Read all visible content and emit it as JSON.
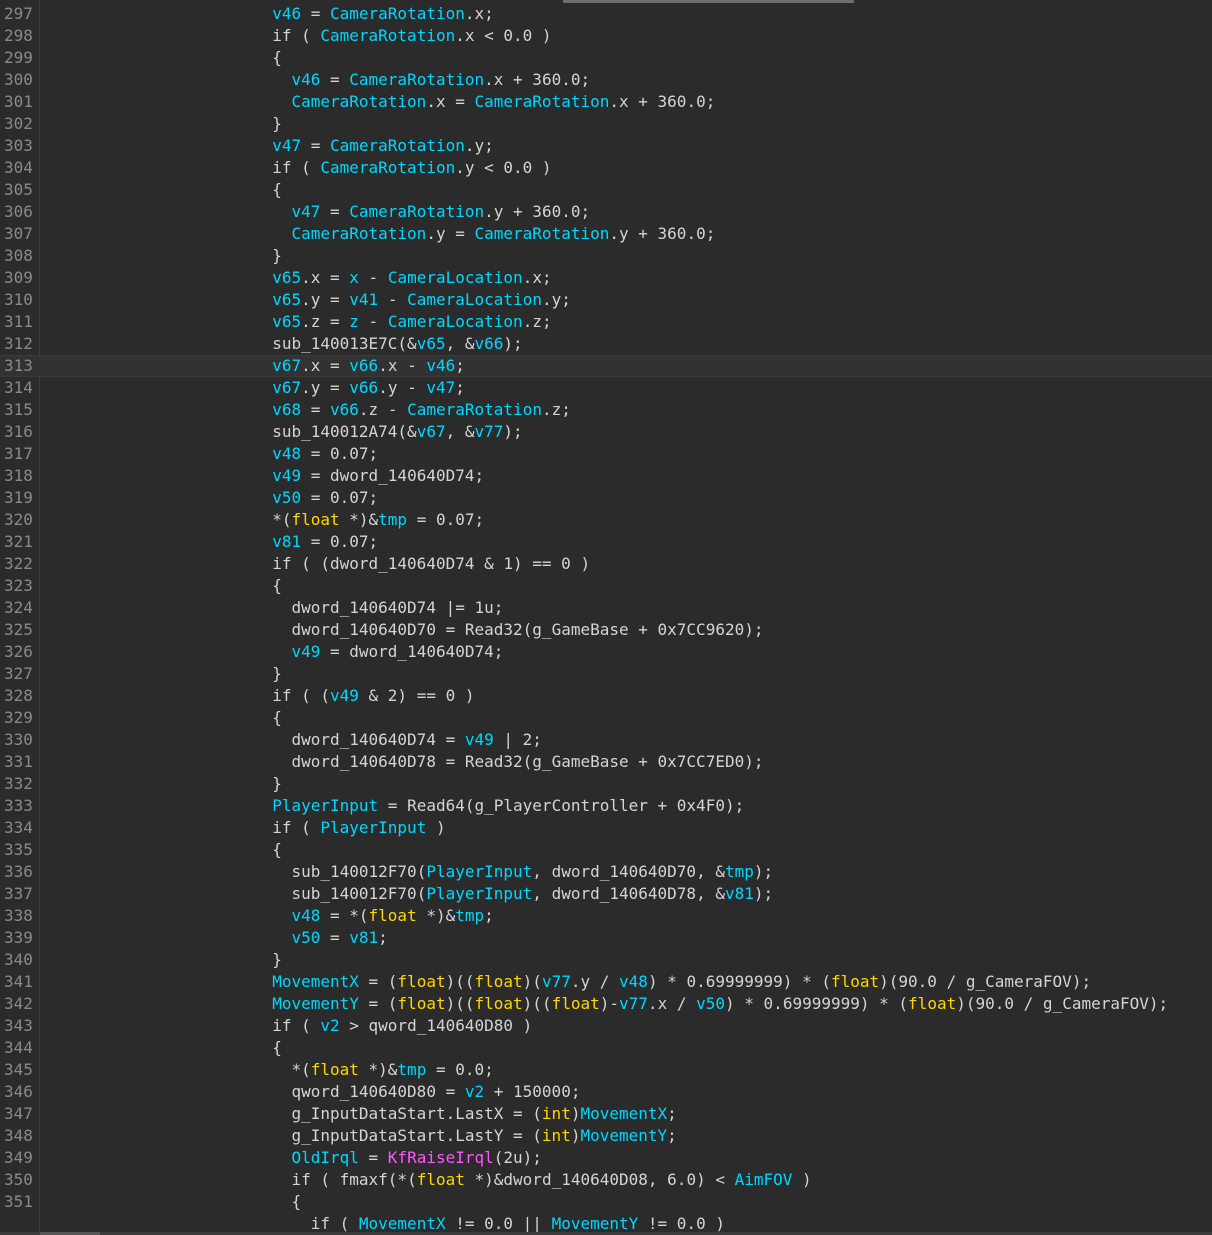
{
  "lines": [
    {
      "n": "297",
      "t": "                        v46 = CameraRotation.x;"
    },
    {
      "n": "298",
      "t": "                        if ( CameraRotation.x < 0.0 )"
    },
    {
      "n": "299",
      "t": "                        {"
    },
    {
      "n": "300",
      "t": "                          v46 = CameraRotation.x + 360.0;"
    },
    {
      "n": "301",
      "t": "                          CameraRotation.x = CameraRotation.x + 360.0;"
    },
    {
      "n": "302",
      "t": "                        }"
    },
    {
      "n": "303",
      "t": "                        v47 = CameraRotation.y;"
    },
    {
      "n": "304",
      "t": "                        if ( CameraRotation.y < 0.0 )"
    },
    {
      "n": "305",
      "t": "                        {"
    },
    {
      "n": "306",
      "t": "                          v47 = CameraRotation.y + 360.0;"
    },
    {
      "n": "307",
      "t": "                          CameraRotation.y = CameraRotation.y + 360.0;"
    },
    {
      "n": "308",
      "t": "                        }"
    },
    {
      "n": "309",
      "t": "                        v65.x = x - CameraLocation.x;"
    },
    {
      "n": "310",
      "t": "                        v65.y = v41 - CameraLocation.y;"
    },
    {
      "n": "311",
      "t": "                        v65.z = z - CameraLocation.z;"
    },
    {
      "n": "312",
      "t": "                        sub_140013E7C(&v65, &v66);"
    },
    {
      "n": "313",
      "t": "                        v67.x = v66.x - v46;"
    },
    {
      "n": "314",
      "t": "                        v67.y = v66.y - v47;"
    },
    {
      "n": "315",
      "t": "                        v68 = v66.z - CameraRotation.z;"
    },
    {
      "n": "316",
      "t": "                        sub_140012A74(&v67, &v77);"
    },
    {
      "n": "317",
      "t": "                        v48 = 0.07;"
    },
    {
      "n": "318",
      "t": "                        v49 = dword_140640D74;"
    },
    {
      "n": "319",
      "t": "                        v50 = 0.07;"
    },
    {
      "n": "320",
      "t": "                        *(float *)&tmp = 0.07;"
    },
    {
      "n": "321",
      "t": "                        v81 = 0.07;"
    },
    {
      "n": "322",
      "t": "                        if ( (dword_140640D74 & 1) == 0 )"
    },
    {
      "n": "323",
      "t": "                        {"
    },
    {
      "n": "324",
      "t": "                          dword_140640D74 |= 1u;"
    },
    {
      "n": "325",
      "t": "                          dword_140640D70 = Read32(g_GameBase + 0x7CC9620);"
    },
    {
      "n": "326",
      "t": "                          v49 = dword_140640D74;"
    },
    {
      "n": "327",
      "t": "                        }"
    },
    {
      "n": "328",
      "t": "                        if ( (v49 & 2) == 0 )"
    },
    {
      "n": "329",
      "t": "                        {"
    },
    {
      "n": "330",
      "t": "                          dword_140640D74 = v49 | 2;"
    },
    {
      "n": "331",
      "t": "                          dword_140640D78 = Read32(g_GameBase + 0x7CC7ED0);"
    },
    {
      "n": "332",
      "t": "                        }"
    },
    {
      "n": "333",
      "t": "                        PlayerInput = Read64(g_PlayerController + 0x4F0);"
    },
    {
      "n": "334",
      "t": "                        if ( PlayerInput )"
    },
    {
      "n": "335",
      "t": "                        {"
    },
    {
      "n": "336",
      "t": "                          sub_140012F70(PlayerInput, dword_140640D70, &tmp);"
    },
    {
      "n": "337",
      "t": "                          sub_140012F70(PlayerInput, dword_140640D78, &v81);"
    },
    {
      "n": "338",
      "t": "                          v48 = *(float *)&tmp;"
    },
    {
      "n": "339",
      "t": "                          v50 = v81;"
    },
    {
      "n": "340",
      "t": "                        }"
    },
    {
      "n": "341",
      "t": "                        MovementX = (float)((float)(v77.y / v48) * 0.69999999) * (float)(90.0 / g_CameraFOV);"
    },
    {
      "n": "342",
      "t": "                        MovementY = (float)((float)((float)-v77.x / v50) * 0.69999999) * (float)(90.0 / g_CameraFOV);"
    },
    {
      "n": "343",
      "t": "                        if ( v2 > qword_140640D80 )"
    },
    {
      "n": "344",
      "t": "                        {"
    },
    {
      "n": "345",
      "t": "                          *(float *)&tmp = 0.0;"
    },
    {
      "n": "346",
      "t": "                          qword_140640D80 = v2 + 150000;"
    },
    {
      "n": "347",
      "t": "                          g_InputDataStart.LastX = (int)MovementX;"
    },
    {
      "n": "348",
      "t": "                          g_InputDataStart.LastY = (int)MovementY;"
    },
    {
      "n": "349",
      "t": "                          OldIrql = KfRaiseIrql(2u);"
    },
    {
      "n": "350",
      "t": "                          if ( fmaxf(*(float *)&dword_140640D08, 6.0) < AimFOV )"
    },
    {
      "n": "351",
      "t": "                          {"
    },
    {
      "n": "",
      "t": "                            if ( MovementX != 0.0 || MovementY != 0.0 )"
    }
  ],
  "current_line": "313",
  "colors": {
    "background": "#2b2b2b",
    "default_text": "#d4d4d4",
    "line_number": "#8a8a8a",
    "identifier": "#00d7ff",
    "keyword_type": "#ffd700",
    "function_import": "#ff55ff"
  },
  "highlight": {
    "identifiers": [
      "CameraRotation",
      "CameraLocation",
      "PlayerInput",
      "MovementX",
      "MovementY",
      "AimFOV",
      "OldIrql",
      "v46",
      "v47",
      "v48",
      "v49",
      "v50",
      "v65",
      "v66",
      "v67",
      "v68",
      "v77",
      "v81",
      "v41",
      "v2",
      "tmp",
      "x",
      "z"
    ],
    "types": [
      "float",
      "int"
    ],
    "imports": [
      "KfRaiseIrql"
    ]
  }
}
